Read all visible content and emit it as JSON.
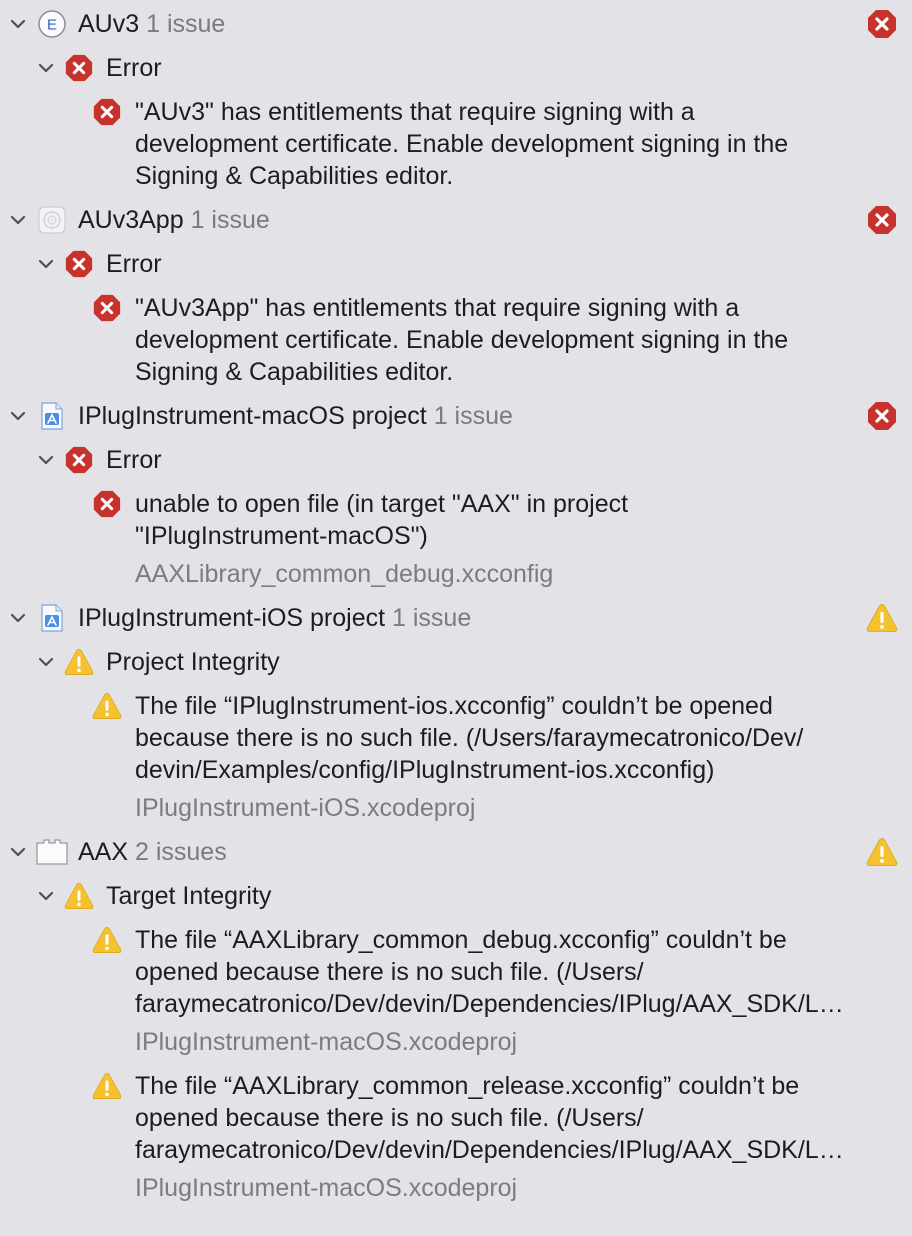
{
  "groups": [
    {
      "name": "AUv3",
      "count": "1 issue",
      "icon": "extension-e-icon",
      "status": "error",
      "category": "Error",
      "category_type": "error",
      "issues": [
        {
          "type": "error",
          "lines": [
            "\"AUv3\" has entitlements that require signing with a",
            "development certificate. Enable development signing in the",
            "Signing & Capabilities editor."
          ],
          "file": ""
        }
      ]
    },
    {
      "name": "AUv3App",
      "count": "1 issue",
      "icon": "app-target-icon",
      "status": "error",
      "category": "Error",
      "category_type": "error",
      "issues": [
        {
          "type": "error",
          "lines": [
            "\"AUv3App\" has entitlements that require signing with a",
            "development certificate. Enable development signing in the",
            "Signing & Capabilities editor."
          ],
          "file": ""
        }
      ]
    },
    {
      "name": "IPlugInstrument-macOS project",
      "count": "1 issue",
      "icon": "xcode-project-icon",
      "status": "error",
      "category": "Error",
      "category_type": "error",
      "issues": [
        {
          "type": "error",
          "lines": [
            "unable to open file (in target \"AAX\" in project",
            "\"IPlugInstrument-macOS\")"
          ],
          "file": "AAXLibrary_common_debug.xcconfig"
        }
      ]
    },
    {
      "name": "IPlugInstrument-iOS project",
      "count": "1 issue",
      "icon": "xcode-project-icon",
      "status": "warning",
      "category": "Project Integrity",
      "category_type": "warning",
      "issues": [
        {
          "type": "warning",
          "lines": [
            "The file “IPlugInstrument-ios.xcconfig” couldn’t be opened",
            "because there is no such file. (/Users/faraymecatronico/Dev/",
            "devin/Examples/config/IPlugInstrument-ios.xcconfig)"
          ],
          "file": "IPlugInstrument-iOS.xcodeproj"
        }
      ]
    },
    {
      "name": "AAX",
      "count": "2 issues",
      "icon": "library-target-icon",
      "status": "warning",
      "category": "Target Integrity",
      "category_type": "warning",
      "issues": [
        {
          "type": "warning",
          "lines": [
            "The file “AAXLibrary_common_debug.xcconfig” couldn’t be",
            "opened because there is no such file. (/Users/",
            "faraymecatronico/Dev/devin/Dependencies/IPlug/AAX_SDK/L…"
          ],
          "file": "IPlugInstrument-macOS.xcodeproj"
        },
        {
          "type": "warning",
          "lines": [
            "The file “AAXLibrary_common_release.xcconfig” couldn’t be",
            "opened because there is no such file. (/Users/",
            "faraymecatronico/Dev/devin/Dependencies/IPlug/AAX_SDK/L…"
          ],
          "file": "IPlugInstrument-macOS.xcodeproj"
        }
      ]
    }
  ],
  "colors": {
    "error": "#c8322c",
    "warning": "#f5c12e",
    "secondary_text": "#7a7a7f"
  }
}
